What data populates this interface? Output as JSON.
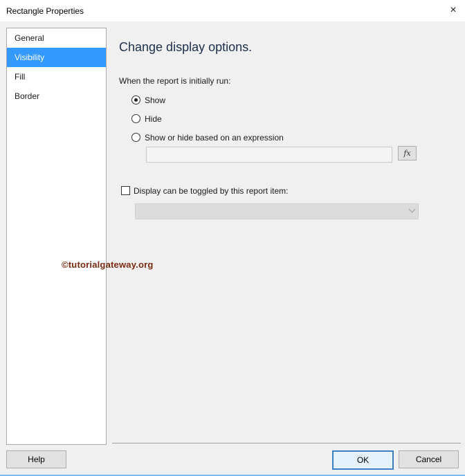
{
  "window": {
    "title": "Rectangle Properties",
    "close_icon": "×"
  },
  "sidebar": {
    "items": [
      {
        "label": "General"
      },
      {
        "label": "Visibility",
        "selected": true
      },
      {
        "label": "Fill"
      },
      {
        "label": "Border"
      }
    ]
  },
  "main": {
    "heading": "Change display options.",
    "initial_label": "When the report is initially run:",
    "options": [
      {
        "label": "Show",
        "checked": true
      },
      {
        "label": "Hide",
        "checked": false
      },
      {
        "label": "Show or hide based on an expression",
        "checked": false
      }
    ],
    "expression_value": "",
    "fx_label": "fx",
    "toggle_label": "Display can be toggled by this report item:",
    "toggle_checked": false,
    "toggle_selected": ""
  },
  "watermark": "©tutorialgateway.org",
  "footer": {
    "help_label": "Help",
    "ok_label": "OK",
    "cancel_label": "Cancel"
  },
  "colors": {
    "selection": "#3399ff",
    "accent_border": "#3c7fc4"
  }
}
